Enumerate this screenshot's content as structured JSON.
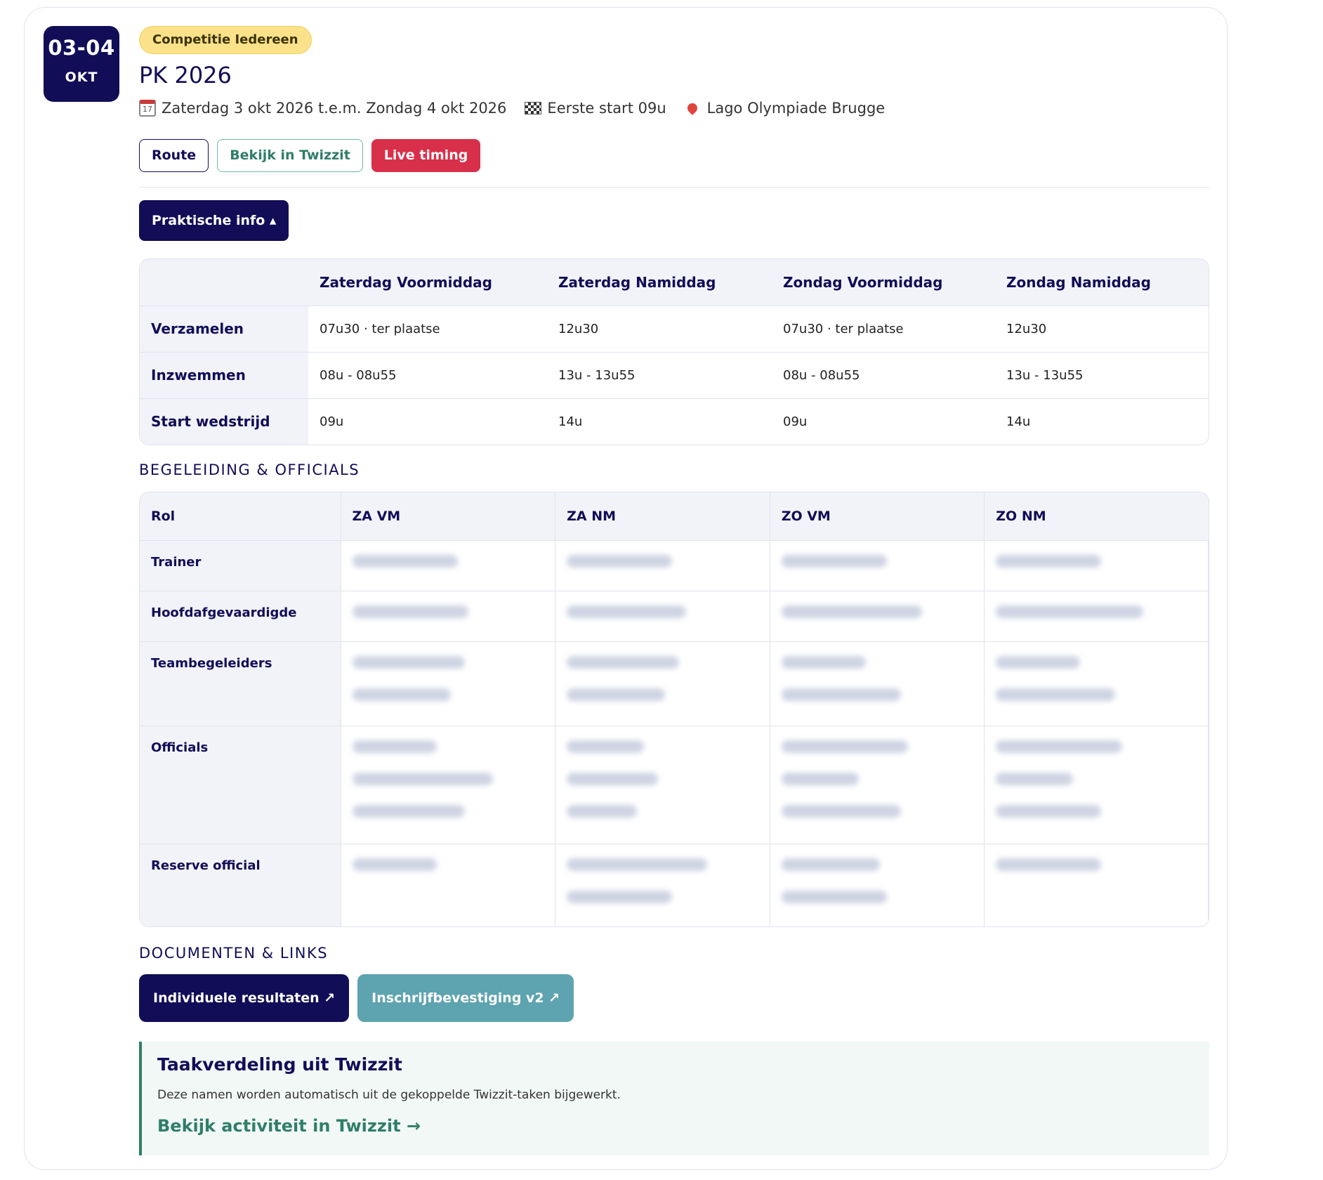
{
  "date_badge": {
    "days": "03-04",
    "month": "OKT"
  },
  "event": {
    "tag": "Competitie Iedereen",
    "title": "PK 2026",
    "date_range": "Zaterdag 3 okt 2026 t.e.m. Zondag 4 okt 2026",
    "first_start": "Eerste start 09u",
    "location": "Lago Olympiade Brugge",
    "calendar_icon_label": "17"
  },
  "actions": {
    "route": "Route",
    "twizzit": "Bekijk in Twizzit",
    "live": "Live timing"
  },
  "practical_toggle": "Praktische info ▴",
  "schedule": {
    "columns": [
      "",
      "Zaterdag Voormiddag",
      "Zaterdag Namiddag",
      "Zondag Voormiddag",
      "Zondag Namiddag"
    ],
    "rows": [
      {
        "label": "Verzamelen",
        "values": [
          "07u30 · ter plaatse",
          "12u30",
          "07u30 · ter plaatse",
          "12u30"
        ]
      },
      {
        "label": "Inzwemmen",
        "values": [
          "08u - 08u55",
          "13u - 13u55",
          "08u - 08u55",
          "13u - 13u55"
        ]
      },
      {
        "label": "Start wedstrijd",
        "values": [
          "09u",
          "14u",
          "09u",
          "14u"
        ]
      }
    ]
  },
  "officials": {
    "heading": "BEGELEIDING & OFFICIALS",
    "columns": [
      "Rol",
      "ZA VM",
      "ZA NM",
      "ZO VM",
      "ZO NM"
    ],
    "rows": [
      "Trainer",
      "Hoofdafgevaardigde",
      "Teambegeleiders",
      "Officials",
      "Reserve official"
    ]
  },
  "documents": {
    "heading": "DOCUMENTEN & LINKS",
    "buttons": [
      "Individuele resultaten ↗",
      "Inschrijfbevestiging v2 ↗"
    ]
  },
  "twizzit_box": {
    "title": "Taakverdeling uit Twizzit",
    "description": "Deze namen worden automatisch uit de gekoppelde Twizzit-taken bijgewerkt.",
    "link": "Bekijk activiteit in Twizzit →"
  },
  "colors": {
    "navy": "#120d57",
    "live_red": "#d8304a",
    "teal": "#2f7e69",
    "tag_yellow": "#fbe28a"
  }
}
